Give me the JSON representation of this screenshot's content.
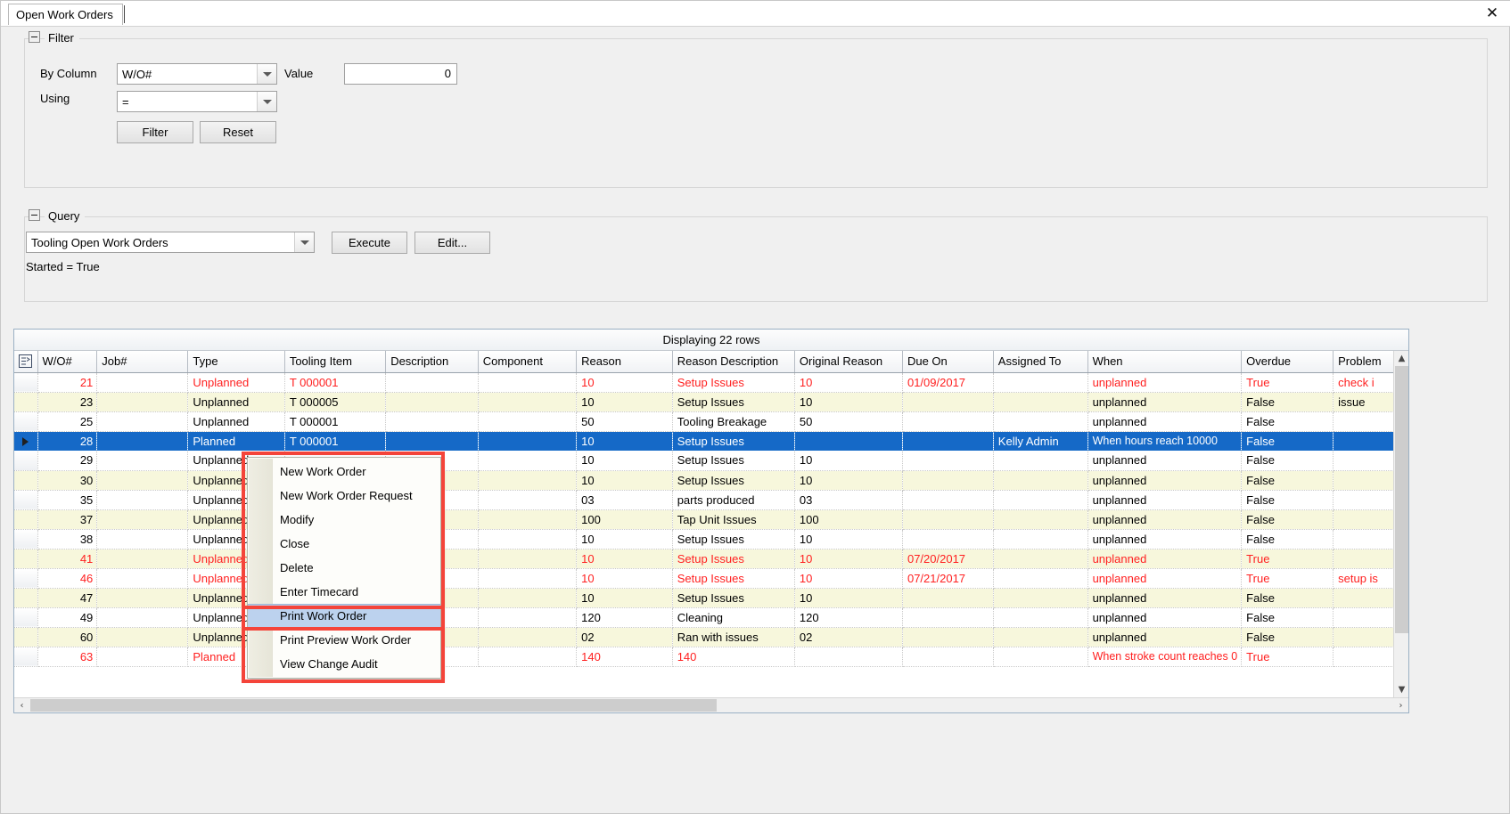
{
  "window": {
    "tab_label": "Open Work Orders",
    "close_label": "✕"
  },
  "filter": {
    "group_title": "Filter",
    "by_column_label": "By Column",
    "by_column_value": "W/O#",
    "value_label": "Value",
    "value_value": "0",
    "using_label": "Using",
    "using_value": "=",
    "filter_button": "Filter",
    "reset_button": "Reset"
  },
  "query": {
    "group_title": "Query",
    "selected_query": "Tooling Open Work Orders",
    "execute_button": "Execute",
    "edit_button": "Edit...",
    "criteria_text": "Started = True"
  },
  "grid": {
    "caption": "Displaying 22 rows",
    "columns": [
      "W/O#",
      "Job#",
      "Type",
      "Tooling Item",
      "Description",
      "Component",
      "Reason",
      "Reason Description",
      "Original Reason",
      "Due On",
      "Assigned To",
      "When",
      "Overdue",
      "Problem"
    ],
    "rows": [
      {
        "wo": "21",
        "job": "",
        "type": "Unplanned",
        "tool": "T 000001",
        "desc": "",
        "comp": "",
        "reason": "10",
        "reasondesc": "Setup Issues",
        "origreason": "10",
        "dueon": "01/09/2017",
        "assigned": "",
        "when": "unplanned",
        "overdue": "True",
        "problem": "check i",
        "red": true,
        "alt": false,
        "selected": false
      },
      {
        "wo": "23",
        "job": "",
        "type": "Unplanned",
        "tool": "T 000005",
        "desc": "",
        "comp": "",
        "reason": "10",
        "reasondesc": "Setup Issues",
        "origreason": "10",
        "dueon": "",
        "assigned": "",
        "when": "unplanned",
        "overdue": "False",
        "problem": "issue",
        "red": false,
        "alt": true,
        "selected": false
      },
      {
        "wo": "25",
        "job": "",
        "type": "Unplanned",
        "tool": "T 000001",
        "desc": "",
        "comp": "",
        "reason": "50",
        "reasondesc": "Tooling Breakage",
        "origreason": "50",
        "dueon": "",
        "assigned": "",
        "when": "unplanned",
        "overdue": "False",
        "problem": "",
        "red": false,
        "alt": false,
        "selected": false
      },
      {
        "wo": "28",
        "job": "",
        "type": "Planned",
        "tool": "T 000001",
        "desc": "",
        "comp": "",
        "reason": "10",
        "reasondesc": "Setup Issues",
        "origreason": "",
        "dueon": "",
        "assigned": "Kelly Admin",
        "when": "When hours reach 10000",
        "overdue": "False",
        "problem": "",
        "red": false,
        "alt": false,
        "selected": true
      },
      {
        "wo": "29",
        "job": "",
        "type": "Unplanned",
        "tool": "",
        "desc": "",
        "comp": "",
        "reason": "10",
        "reasondesc": "Setup Issues",
        "origreason": "10",
        "dueon": "",
        "assigned": "",
        "when": "unplanned",
        "overdue": "False",
        "problem": "",
        "red": false,
        "alt": false,
        "selected": false
      },
      {
        "wo": "30",
        "job": "",
        "type": "Unplanned",
        "tool": "",
        "desc": "",
        "comp": "",
        "reason": "10",
        "reasondesc": "Setup Issues",
        "origreason": "10",
        "dueon": "",
        "assigned": "",
        "when": "unplanned",
        "overdue": "False",
        "problem": "",
        "red": false,
        "alt": true,
        "selected": false
      },
      {
        "wo": "35",
        "job": "",
        "type": "Unplanned",
        "tool": "",
        "desc": "",
        "comp": "",
        "reason": "03",
        "reasondesc": "parts produced",
        "origreason": "03",
        "dueon": "",
        "assigned": "",
        "when": "unplanned",
        "overdue": "False",
        "problem": "",
        "red": false,
        "alt": false,
        "selected": false
      },
      {
        "wo": "37",
        "job": "",
        "type": "Unplanned",
        "tool": "",
        "desc": "",
        "comp": "",
        "reason": "100",
        "reasondesc": "Tap Unit Issues",
        "origreason": "100",
        "dueon": "",
        "assigned": "",
        "when": "unplanned",
        "overdue": "False",
        "problem": "",
        "red": false,
        "alt": true,
        "selected": false
      },
      {
        "wo": "38",
        "job": "",
        "type": "Unplanned",
        "tool": "",
        "desc": "",
        "comp": "",
        "reason": "10",
        "reasondesc": "Setup Issues",
        "origreason": "10",
        "dueon": "",
        "assigned": "",
        "when": "unplanned",
        "overdue": "False",
        "problem": "",
        "red": false,
        "alt": false,
        "selected": false
      },
      {
        "wo": "41",
        "job": "",
        "type": "Unplanned",
        "tool": "",
        "desc": "",
        "comp": "",
        "reason": "10",
        "reasondesc": "Setup Issues",
        "origreason": "10",
        "dueon": "07/20/2017",
        "assigned": "",
        "when": "unplanned",
        "overdue": "True",
        "problem": "",
        "red": true,
        "alt": true,
        "selected": false
      },
      {
        "wo": "46",
        "job": "",
        "type": "Unplanned",
        "tool": "",
        "desc": "",
        "comp": "",
        "reason": "10",
        "reasondesc": "Setup Issues",
        "origreason": "10",
        "dueon": "07/21/2017",
        "assigned": "",
        "when": "unplanned",
        "overdue": "True",
        "problem": "setup is",
        "red": true,
        "alt": false,
        "selected": false
      },
      {
        "wo": "47",
        "job": "",
        "type": "Unplanned",
        "tool": "",
        "desc": "",
        "comp": "",
        "reason": "10",
        "reasondesc": "Setup Issues",
        "origreason": "10",
        "dueon": "",
        "assigned": "",
        "when": "unplanned",
        "overdue": "False",
        "problem": "",
        "red": false,
        "alt": true,
        "selected": false
      },
      {
        "wo": "49",
        "job": "",
        "type": "Unplanned",
        "tool": "",
        "desc": "",
        "comp": "",
        "reason": "120",
        "reasondesc": "Cleaning",
        "origreason": "120",
        "dueon": "",
        "assigned": "",
        "when": "unplanned",
        "overdue": "False",
        "problem": "",
        "red": false,
        "alt": false,
        "selected": false
      },
      {
        "wo": "60",
        "job": "",
        "type": "Unplanned",
        "tool": "",
        "desc": "",
        "comp": "",
        "reason": "02",
        "reasondesc": "Ran with issues",
        "origreason": "02",
        "dueon": "",
        "assigned": "",
        "when": "unplanned",
        "overdue": "False",
        "problem": "",
        "red": false,
        "alt": true,
        "selected": false
      },
      {
        "wo": "63",
        "job": "",
        "type": "Planned",
        "tool": "",
        "desc": "",
        "comp": "",
        "reason": "140",
        "reasondesc": "140",
        "origreason": "",
        "dueon": "",
        "assigned": "",
        "when": "When stroke count reaches 0",
        "overdue": "True",
        "problem": "",
        "red": true,
        "alt": false,
        "selected": false
      }
    ]
  },
  "context_menu": {
    "items": [
      {
        "label": "New Work Order",
        "selected": false
      },
      {
        "label": "New Work Order Request",
        "selected": false
      },
      {
        "label": "Modify",
        "selected": false
      },
      {
        "label": "Close",
        "selected": false
      },
      {
        "label": "Delete",
        "selected": false
      },
      {
        "label": "Enter Timecard",
        "selected": false
      },
      {
        "label": "Print Work Order",
        "selected": true
      },
      {
        "label": "Print Preview Work Order",
        "selected": false
      },
      {
        "label": "View Change Audit",
        "selected": false
      }
    ]
  },
  "scroll": {
    "up_arrow": "▲",
    "down_arrow": "▼",
    "left_arrow": "‹",
    "right_arrow": "›"
  },
  "colors": {
    "selection_blue": "#1569c7",
    "alt_row": "#f7f7dc",
    "overdue_red": "#ff2020",
    "annotation_red": "#f4443a",
    "menu_highlight": "#bcd2ee"
  }
}
